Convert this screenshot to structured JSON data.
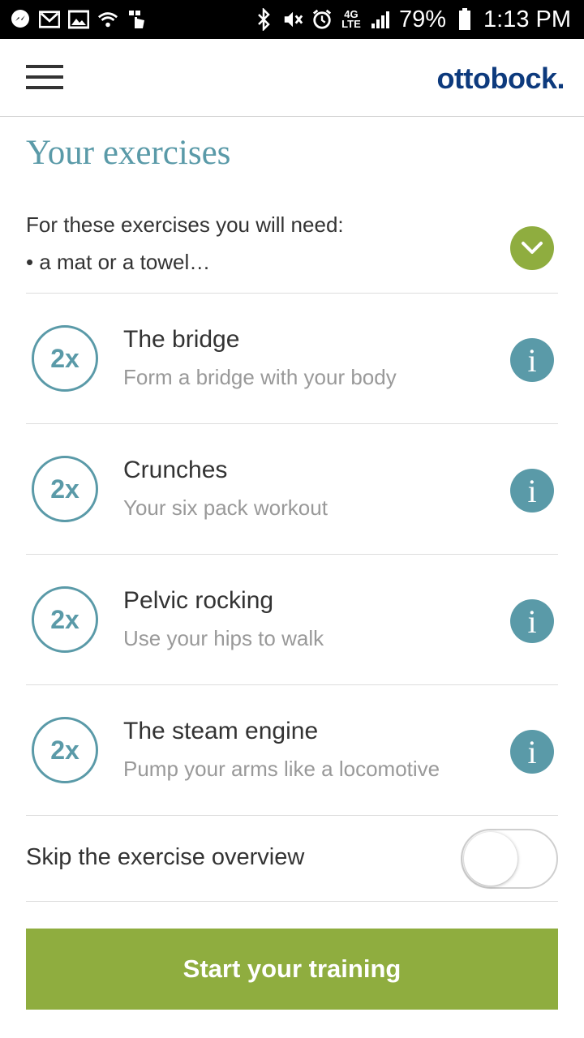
{
  "status_bar": {
    "battery": "79%",
    "time": "1:13 PM",
    "network": "4G",
    "network_sub": "LTE"
  },
  "header": {
    "brand": "ottobock.",
    "brand_color": "#0d3a7d"
  },
  "main": {
    "title": "Your exercises",
    "needs_line1": "For these exercises you will need:",
    "needs_line2": "• a mat or a towel…",
    "exercises": [
      {
        "reps": "2x",
        "title": "The bridge",
        "subtitle": "Form a bridge with your body"
      },
      {
        "reps": "2x",
        "title": "Crunches",
        "subtitle": "Your six pack workout"
      },
      {
        "reps": "2x",
        "title": "Pelvic rocking",
        "subtitle": "Use your hips to walk"
      },
      {
        "reps": "2x",
        "title": "The steam engine",
        "subtitle": "Pump your arms like a locomotive"
      }
    ],
    "info_glyph": "i",
    "skip_label": "Skip the exercise overview",
    "skip_enabled": false,
    "start_label": "Start your training"
  },
  "colors": {
    "accent_teal": "#5a9aa8",
    "accent_green": "#8fad3f"
  },
  "icons": {
    "status_left": [
      "messenger-icon",
      "gmail-icon",
      "gallery-icon",
      "wifi-question-icon",
      "touch-icon"
    ],
    "status_right": [
      "bluetooth-icon",
      "mute-icon",
      "alarm-icon",
      "signal-icon",
      "battery-icon"
    ]
  }
}
